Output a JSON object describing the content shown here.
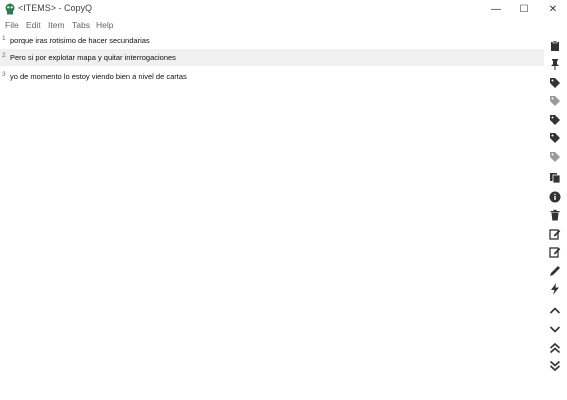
{
  "window": {
    "title": "<ITEMS> - CopyQ",
    "minimize": "—",
    "maximize": "☐",
    "close": "✕"
  },
  "menu": [
    "File",
    "Edit",
    "Item",
    "Tabs",
    "Help"
  ],
  "items": [
    {
      "num": "1",
      "text": "porque iras rotisimo de hacer secundarias"
    },
    {
      "num": "2",
      "text": "Pero si por explotar mapa y quitar interrogaciones"
    },
    {
      "num": "3",
      "text": "yo de momento lo estoy viendo bien a nivel de cartas"
    }
  ],
  "toolbar_icons": [
    "paste-icon",
    "pin-icon",
    "tag-icon",
    "tag-light-icon",
    "tag-icon",
    "tag-icon",
    "tag-light-icon",
    "copy-icon",
    "info-icon",
    "trash-icon",
    "edit-icon",
    "edit-alt-icon",
    "pencil-icon",
    "lightning-icon",
    "chevron-up-icon",
    "chevron-down-icon",
    "double-chevron-up-icon",
    "double-chevron-down-icon"
  ],
  "colors": {
    "icon": "#333333",
    "icon_light": "#9a9a9a",
    "alt_row": "#f0f0f0"
  }
}
